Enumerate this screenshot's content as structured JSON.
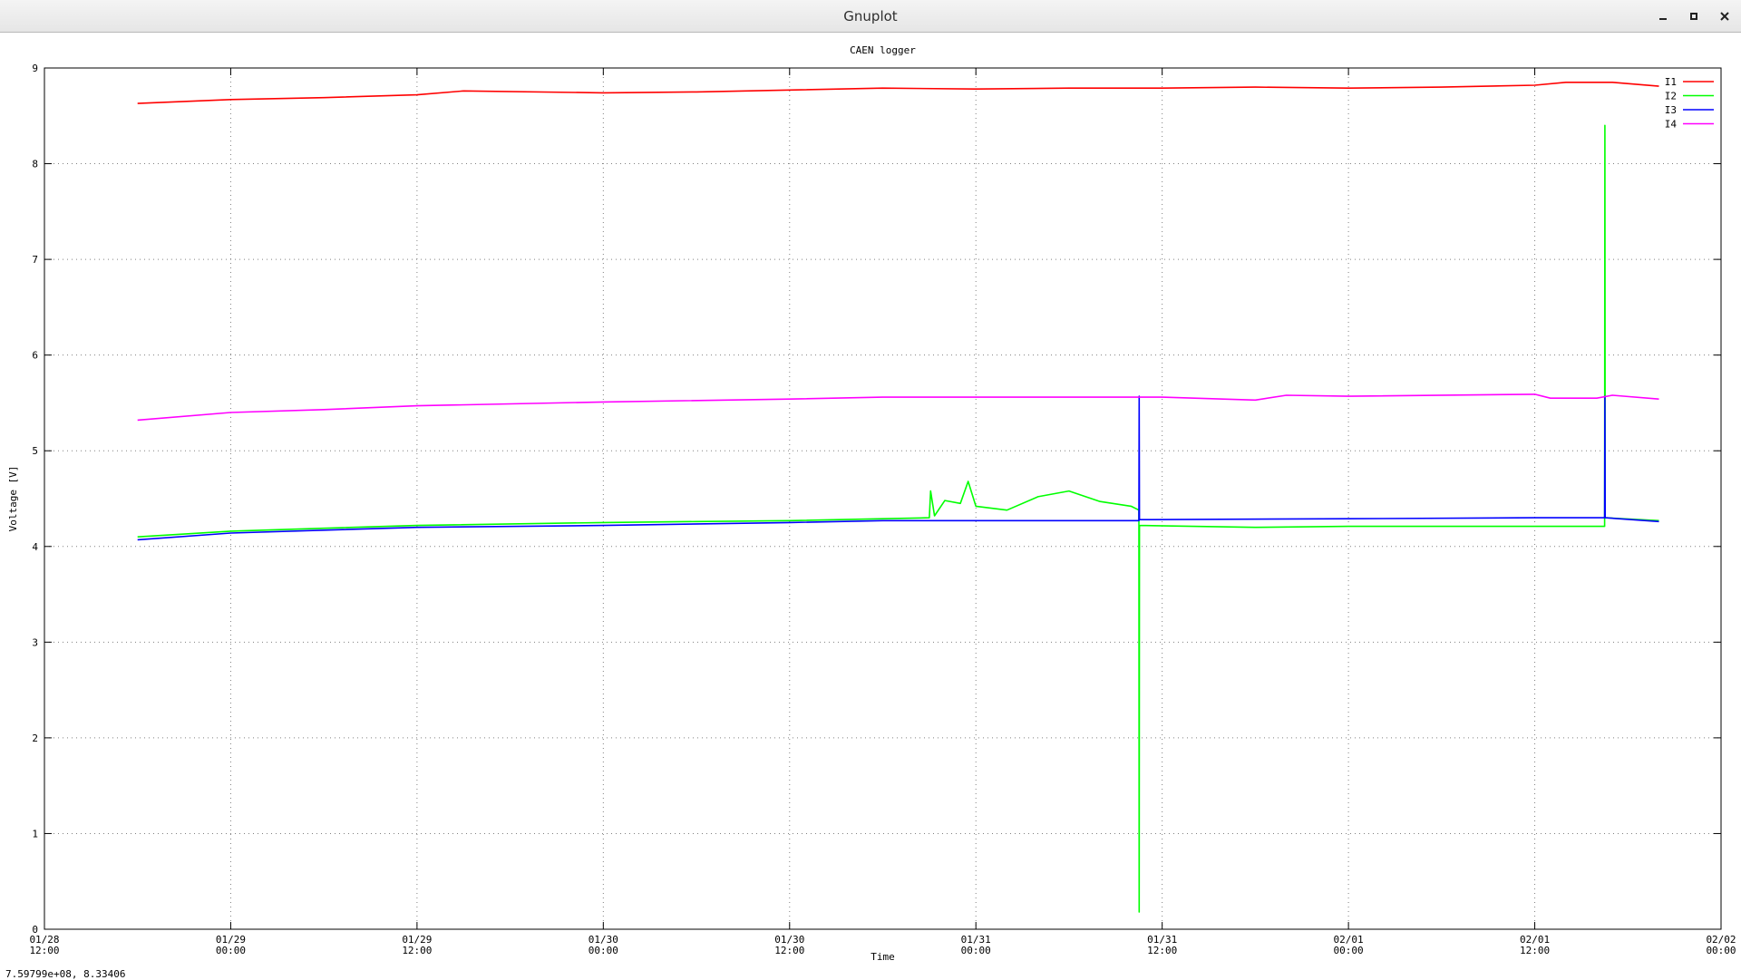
{
  "window": {
    "title": "Gnuplot",
    "minimize_icon": "minimize-icon",
    "maximize_icon": "maximize-icon",
    "close_icon": "close-icon"
  },
  "status_bar": {
    "coordinates": "7.59799e+08,  8.33406"
  },
  "chart_data": {
    "type": "line",
    "title": "CAEN logger",
    "xlabel": "Time",
    "ylabel": "Voltage [V]",
    "x_type": "time",
    "xlim": [
      "01/28 12:00",
      "02/02 00:00"
    ],
    "ylim": [
      0,
      9
    ],
    "grid": true,
    "grid_style": "dotted",
    "legend_position": "top-right",
    "x_ticks": [
      {
        "x": "01/28 12:00",
        "label": [
          "01/28",
          "12:00"
        ]
      },
      {
        "x": "01/29 00:00",
        "label": [
          "01/29",
          "00:00"
        ]
      },
      {
        "x": "01/29 12:00",
        "label": [
          "01/29",
          "12:00"
        ]
      },
      {
        "x": "01/30 00:00",
        "label": [
          "01/30",
          "00:00"
        ]
      },
      {
        "x": "01/30 12:00",
        "label": [
          "01/30",
          "12:00"
        ]
      },
      {
        "x": "01/31 00:00",
        "label": [
          "01/31",
          "00:00"
        ]
      },
      {
        "x": "01/31 12:00",
        "label": [
          "01/31",
          "12:00"
        ]
      },
      {
        "x": "02/01 00:00",
        "label": [
          "02/01",
          "00:00"
        ]
      },
      {
        "x": "02/01 12:00",
        "label": [
          "02/01",
          "12:00"
        ]
      },
      {
        "x": "02/02 00:00",
        "label": [
          "02/02",
          "00:00"
        ]
      }
    ],
    "y_ticks": [
      0,
      1,
      2,
      3,
      4,
      5,
      6,
      7,
      8,
      9
    ],
    "series": [
      {
        "name": "I1",
        "color": "#ff0000",
        "points": [
          [
            "01/28 18:00",
            8.63
          ],
          [
            "01/29 00:00",
            8.67
          ],
          [
            "01/29 06:00",
            8.69
          ],
          [
            "01/29 12:00",
            8.72
          ],
          [
            "01/29 15:00",
            8.76
          ],
          [
            "01/30 00:00",
            8.74
          ],
          [
            "01/30 06:00",
            8.75
          ],
          [
            "01/30 12:00",
            8.77
          ],
          [
            "01/30 18:00",
            8.79
          ],
          [
            "01/31 00:00",
            8.78
          ],
          [
            "01/31 06:00",
            8.79
          ],
          [
            "01/31 12:00",
            8.79
          ],
          [
            "01/31 18:00",
            8.8
          ],
          [
            "02/01 00:00",
            8.79
          ],
          [
            "02/01 06:00",
            8.8
          ],
          [
            "02/01 12:00",
            8.82
          ],
          [
            "02/01 14:00",
            8.85
          ],
          [
            "02/01 17:00",
            8.85
          ],
          [
            "02/01 20:00",
            8.81
          ]
        ]
      },
      {
        "name": "I2",
        "color": "#00ff00",
        "points": [
          [
            "01/28 18:00",
            4.1
          ],
          [
            "01/29 00:00",
            4.16
          ],
          [
            "01/29 06:00",
            4.19
          ],
          [
            "01/29 12:00",
            4.22
          ],
          [
            "01/30 00:00",
            4.25
          ],
          [
            "01/30 06:00",
            4.26
          ],
          [
            "01/30 12:00",
            4.27
          ],
          [
            "01/30 18:00",
            4.29
          ],
          [
            "01/30 21:00",
            4.3
          ],
          [
            "01/30 21:05",
            4.58
          ],
          [
            "01/30 21:20",
            4.32
          ],
          [
            "01/30 22:00",
            4.48
          ],
          [
            "01/30 23:00",
            4.45
          ],
          [
            "01/30 23:30",
            4.68
          ],
          [
            "01/31 00:00",
            4.42
          ],
          [
            "01/31 02:00",
            4.38
          ],
          [
            "01/31 04:00",
            4.52
          ],
          [
            "01/31 06:00",
            4.58
          ],
          [
            "01/31 08:00",
            4.47
          ],
          [
            "01/31 10:00",
            4.42
          ],
          [
            "01/31 10:30",
            4.38
          ],
          [
            "01/31 10:31",
            0.18
          ],
          [
            "01/31 10:32",
            4.22
          ],
          [
            "01/31 18:00",
            4.2
          ],
          [
            "02/01 00:00",
            4.21
          ],
          [
            "02/01 12:00",
            4.21
          ],
          [
            "02/01 16:30",
            4.21
          ],
          [
            "02/01 16:31",
            8.4
          ],
          [
            "02/01 16:32",
            4.3
          ],
          [
            "02/01 20:00",
            4.27
          ]
        ]
      },
      {
        "name": "I3",
        "color": "#0000ff",
        "points": [
          [
            "01/28 18:00",
            4.07
          ],
          [
            "01/29 00:00",
            4.14
          ],
          [
            "01/29 06:00",
            4.17
          ],
          [
            "01/29 12:00",
            4.2
          ],
          [
            "01/30 00:00",
            4.22
          ],
          [
            "01/30 12:00",
            4.25
          ],
          [
            "01/30 18:00",
            4.27
          ],
          [
            "01/31 00:00",
            4.27
          ],
          [
            "01/31 10:30",
            4.27
          ],
          [
            "01/31 10:31",
            5.57
          ],
          [
            "01/31 10:32",
            4.28
          ],
          [
            "02/01 00:00",
            4.29
          ],
          [
            "02/01 12:00",
            4.3
          ],
          [
            "02/01 16:30",
            4.3
          ],
          [
            "02/01 16:31",
            5.57
          ],
          [
            "02/01 16:32",
            4.3
          ],
          [
            "02/01 20:00",
            4.26
          ]
        ]
      },
      {
        "name": "I4",
        "color": "#ff00ff",
        "points": [
          [
            "01/28 18:00",
            5.32
          ],
          [
            "01/29 00:00",
            5.4
          ],
          [
            "01/29 06:00",
            5.43
          ],
          [
            "01/29 12:00",
            5.47
          ],
          [
            "01/30 00:00",
            5.51
          ],
          [
            "01/30 12:00",
            5.54
          ],
          [
            "01/30 18:00",
            5.56
          ],
          [
            "01/31 00:00",
            5.56
          ],
          [
            "01/31 12:00",
            5.56
          ],
          [
            "01/31 18:00",
            5.53
          ],
          [
            "01/31 20:00",
            5.58
          ],
          [
            "02/01 00:00",
            5.57
          ],
          [
            "02/01 12:00",
            5.59
          ],
          [
            "02/01 13:00",
            5.55
          ],
          [
            "02/01 16:00",
            5.55
          ],
          [
            "02/01 17:00",
            5.58
          ],
          [
            "02/01 20:00",
            5.54
          ]
        ]
      }
    ]
  }
}
